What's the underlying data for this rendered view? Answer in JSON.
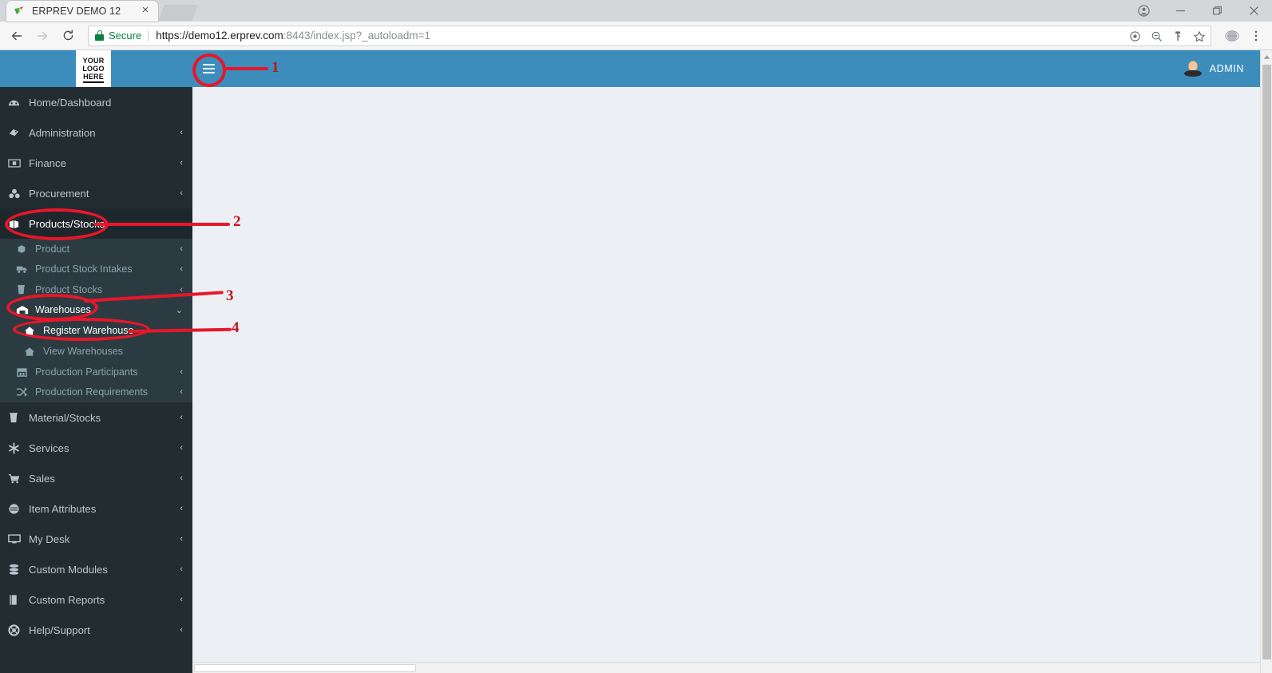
{
  "browser": {
    "tab": {
      "title": "ERPREV DEMO 12",
      "close": "×",
      "favicon": "bird-favicon"
    },
    "window_controls": {
      "profile": "profile-icon",
      "minimize": "—",
      "maximize": "❐",
      "close": "✕"
    },
    "nav": {
      "back": "←",
      "forward": "→",
      "reload": "↻"
    },
    "omnibox": {
      "security_label": "Secure",
      "url_prefix": "https://demo12.erprev.com",
      "url_port": ":8443",
      "url_path": "/index.jsp?_autoloadm=1",
      "full_url": "https://demo12.erprev.com:8443/index.jsp?_autoloadm=1",
      "icons": [
        "target-icon",
        "zoom-out-icon",
        "key-icon",
        "star-icon"
      ]
    },
    "toolbar_right": {
      "extension": "globe-extension-icon",
      "menu": "three-dot-menu-icon"
    }
  },
  "app": {
    "logo": {
      "line1": "YOUR",
      "line2": "LOGO",
      "line3": "HERE"
    },
    "sidebar_toggle": "hamburger-icon",
    "user": {
      "name": "ADMIN",
      "avatar": "user-avatar-icon"
    },
    "colors": {
      "header_blue": "#3c8dbc",
      "sidebar_dark": "#222d32",
      "sidebar_active": "#1e282c",
      "submenu": "#2c3b41",
      "content_bg": "#ecf0f5",
      "annotation_red": "#e8162a"
    }
  },
  "sidebar": {
    "items": [
      {
        "label": "Home/Dashboard",
        "icon": "dashboard-icon",
        "arrow": "",
        "state": "normal"
      },
      {
        "label": "Administration",
        "icon": "tags-icon",
        "arrow": "‹",
        "state": "normal"
      },
      {
        "label": "Finance",
        "icon": "money-icon",
        "arrow": "‹",
        "state": "normal"
      },
      {
        "label": "Procurement",
        "icon": "cubes-icon",
        "arrow": "‹",
        "state": "normal"
      },
      {
        "label": "Products/Stocks",
        "icon": "box-open-icon",
        "arrow": "",
        "state": "active"
      }
    ],
    "submenu": [
      {
        "label": "Product",
        "icon": "cube-icon",
        "arrow": "‹",
        "state": "normal"
      },
      {
        "label": "Product Stock Intakes",
        "icon": "truck-icon",
        "arrow": "‹",
        "state": "normal"
      },
      {
        "label": "Product Stocks",
        "icon": "trash-stock-icon",
        "arrow": "‹",
        "state": "normal"
      },
      {
        "label": "Warehouses",
        "icon": "warehouse-icon",
        "arrow": "⌄",
        "state": "selected"
      }
    ],
    "warehouse_children": [
      {
        "label": "Register Warehouse",
        "icon": "home-icon",
        "state": "selected"
      },
      {
        "label": "View Warehouses",
        "icon": "home-icon",
        "state": "normal"
      }
    ],
    "submenu_tail": [
      {
        "label": "Production Participants",
        "icon": "factory-icon",
        "arrow": "‹",
        "state": "normal"
      },
      {
        "label": "Production Requirements",
        "icon": "shuffle-icon",
        "arrow": "‹",
        "state": "normal"
      }
    ],
    "items_after": [
      {
        "label": "Material/Stocks",
        "icon": "trash-stock-icon",
        "arrow": "‹",
        "state": "normal"
      },
      {
        "label": "Services",
        "icon": "asterisk-icon",
        "arrow": "‹",
        "state": "normal"
      },
      {
        "label": "Sales",
        "icon": "cart-icon",
        "arrow": "‹",
        "state": "normal"
      },
      {
        "label": "Item Attributes",
        "icon": "disc-icon",
        "arrow": "‹",
        "state": "normal"
      },
      {
        "label": "My Desk",
        "icon": "monitor-icon",
        "arrow": "‹",
        "state": "normal"
      },
      {
        "label": "Custom Modules",
        "icon": "database-icon",
        "arrow": "‹",
        "state": "normal"
      },
      {
        "label": "Custom Reports",
        "icon": "book-icon",
        "arrow": "‹",
        "state": "normal"
      },
      {
        "label": "Help/Support",
        "icon": "lifebuoy-icon",
        "arrow": "‹",
        "state": "normal"
      }
    ]
  },
  "annotations": [
    {
      "number": "1",
      "target": "sidebar-toggle"
    },
    {
      "number": "2",
      "target": "Products/Stocks"
    },
    {
      "number": "3",
      "target": "Warehouses"
    },
    {
      "number": "4",
      "target": "Register Warehouse"
    }
  ]
}
